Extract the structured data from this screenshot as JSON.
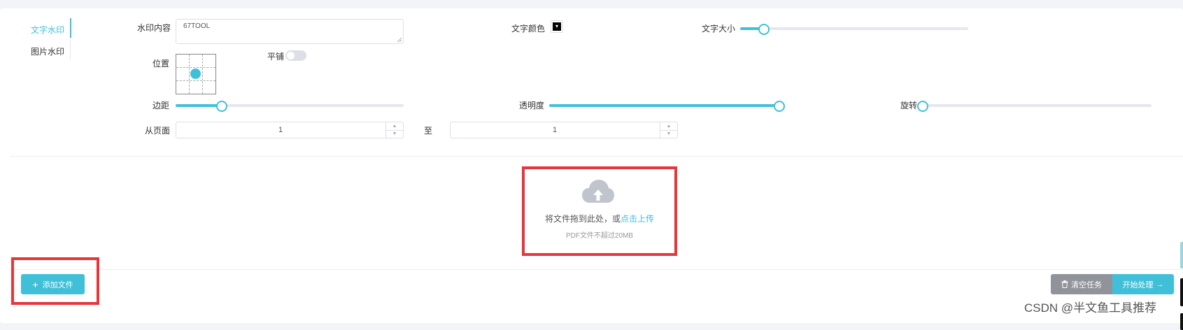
{
  "tabs": [
    {
      "label": "文字水印",
      "active": true
    },
    {
      "label": "图片水印",
      "active": false
    }
  ],
  "form": {
    "content_label": "水印内容",
    "content_value": "67TOOL",
    "color_label": "文字颜色",
    "color_value": "#000000",
    "size_label": "文字大小",
    "size_fraction": 0.1,
    "position_label": "位置",
    "tile_label": "平铺",
    "tile_on": false,
    "margin_label": "边距",
    "margin_fraction": 0.2,
    "opacity_label": "透明度",
    "opacity_fraction": 1.0,
    "rotate_label": "旋转",
    "rotate_fraction": 0.0,
    "from_page_label": "从页面",
    "from_page_value": "1",
    "to_label": "至",
    "to_page_value": "1"
  },
  "upload": {
    "text": "将文件拖到此处，或",
    "link": "点击上传",
    "tip": "PDF文件不超过20MB"
  },
  "actions": {
    "add_file": "添加文件",
    "clear_tasks": "清空任务",
    "start": "开始处理"
  },
  "watermark_text": "CSDN @半文鱼工具推荐",
  "colors": {
    "accent": "#40c0d8",
    "highlight": "#e8353a",
    "secondary_button": "#909399"
  },
  "icons": [
    "cloud-upload-icon",
    "plus-icon",
    "trash-icon",
    "arrow-right-icon",
    "chevron-up-icon",
    "chevron-down-icon"
  ]
}
